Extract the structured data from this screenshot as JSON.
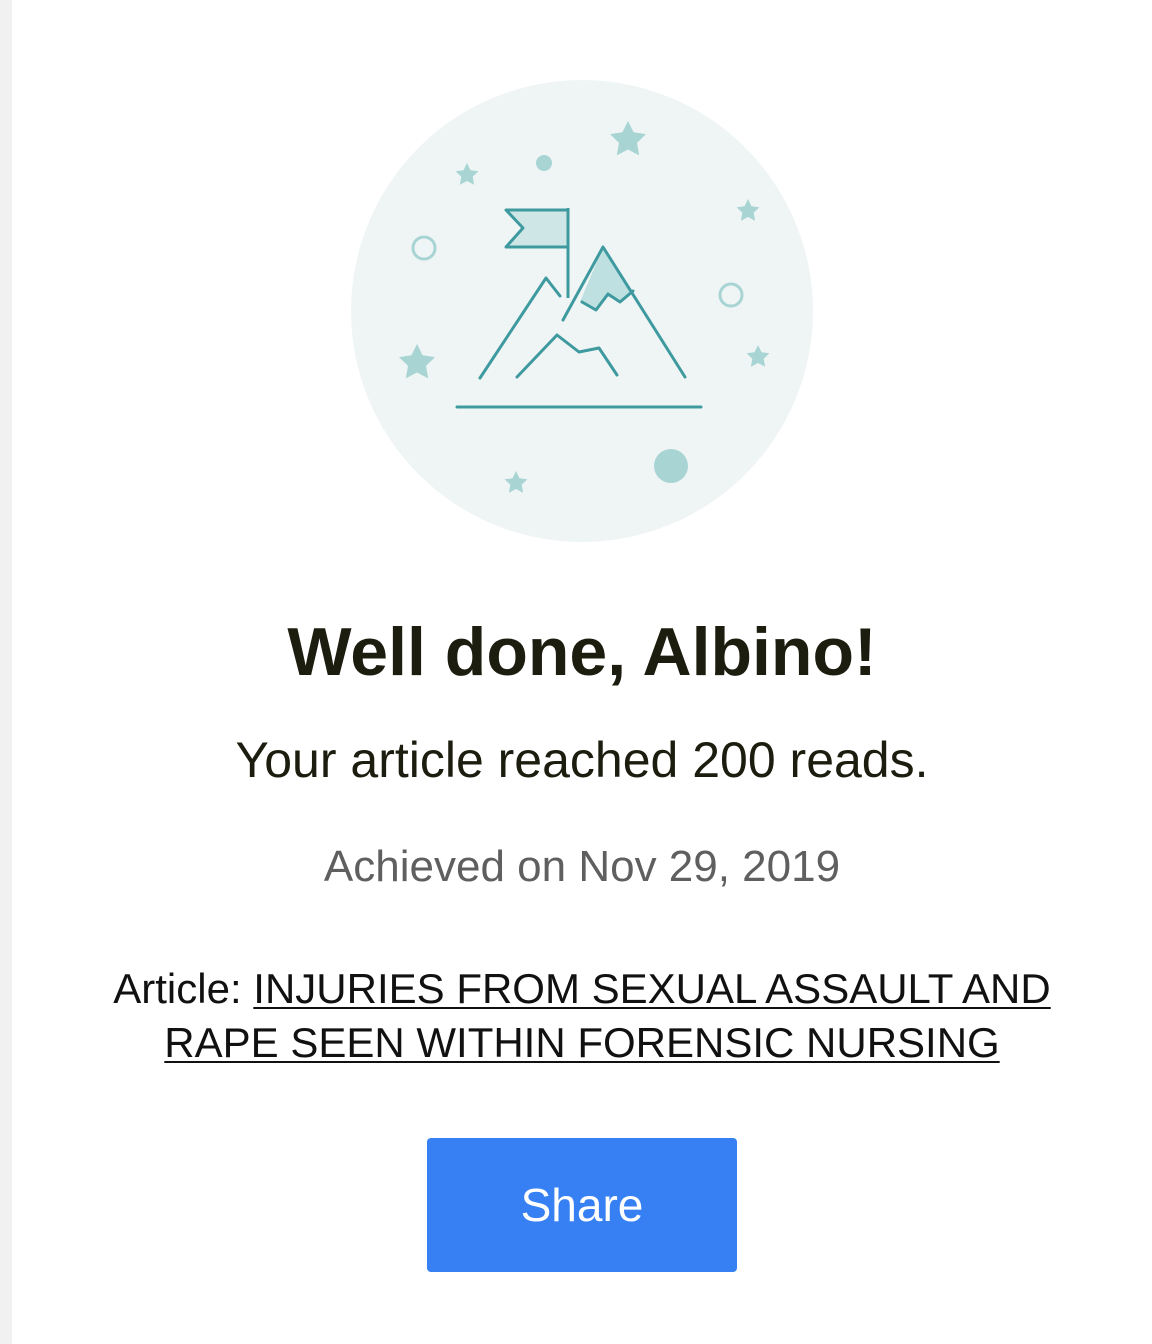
{
  "colors": {
    "accent": "#3680f3",
    "illustration_bg": "#eff5f5",
    "illustration_line": "#3f9aa0",
    "illustration_fill": "#a9d4d4"
  },
  "milestone": {
    "icon": "mountain-flag-achievement-icon",
    "title": "Well done, Albino!",
    "subtitle": "Your article reached 200 reads.",
    "achieved": "Achieved on Nov 29, 2019",
    "article_prefix": "Article:",
    "article_title": "INJURIES FROM SEXUAL ASSAULT AND RAPE SEEN WITHIN FORENSIC NURSING"
  },
  "actions": {
    "share_label": "Share"
  }
}
